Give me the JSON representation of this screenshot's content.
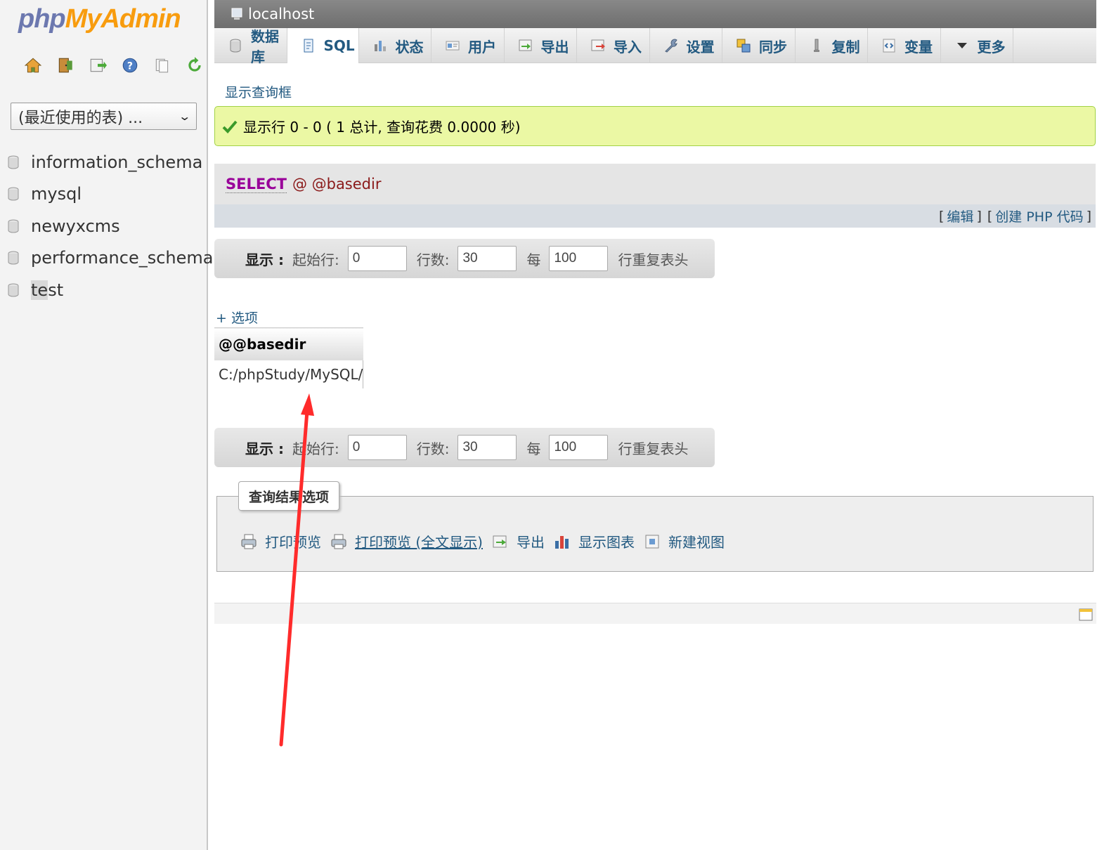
{
  "logo": {
    "part1": "php",
    "part2": "MyAdmin"
  },
  "nav_icons": [
    "home-icon",
    "logout-icon",
    "query-window-icon",
    "help-icon",
    "docs-icon",
    "reload-icon"
  ],
  "recent_tables": {
    "selected": "(最近使用的表) ..."
  },
  "databases": [
    {
      "name": "information_schema"
    },
    {
      "name": "mysql"
    },
    {
      "name": "newyxcms"
    },
    {
      "name": "performance_schema"
    },
    {
      "name_a": "te",
      "name_b": "st"
    }
  ],
  "server": {
    "title": "localhost"
  },
  "tabs": [
    {
      "label": "数据库",
      "icon": "database-icon"
    },
    {
      "label": "SQL",
      "icon": "sql-icon"
    },
    {
      "label": "状态",
      "icon": "status-icon"
    },
    {
      "label": "用户",
      "icon": "users-icon"
    },
    {
      "label": "导出",
      "icon": "export-icon"
    },
    {
      "label": "导入",
      "icon": "import-icon"
    },
    {
      "label": "设置",
      "icon": "settings-icon"
    },
    {
      "label": "同步",
      "icon": "sync-icon"
    },
    {
      "label": "复制",
      "icon": "replication-icon"
    },
    {
      "label": "变量",
      "icon": "variables-icon"
    },
    {
      "label": "更多",
      "icon": "chevron-down-icon"
    }
  ],
  "show_query_box": "显示查询框",
  "success_message": "显示行 0 - 0 ( 1 总计, 查询花费 0.0000 秒)",
  "sql": {
    "keyword": "SELECT",
    "rest": "@ @basedir"
  },
  "sql_tools": {
    "open1": "[",
    "edit": "编辑",
    "close1": "]",
    "open2": "[",
    "create_php": "创建 PHP 代码",
    "close2": "]"
  },
  "navigation": {
    "show_label": "显示 :",
    "start_row_label": "起始行:",
    "start_row_value": "0",
    "rows_label": "行数:",
    "rows_value": "30",
    "every_label": "每",
    "repeat_value": "100",
    "repeat_header_label": "行重复表头"
  },
  "options_link": "+ 选项",
  "result": {
    "column": "@@basedir",
    "value": "C:/phpStudy/MySQL/"
  },
  "query_results_options": {
    "legend": "查询结果选项",
    "links": [
      {
        "label": "打印预览",
        "icon": "print-icon"
      },
      {
        "label": "打印预览 (全文显示)",
        "icon": "print-full-icon"
      },
      {
        "label": "导出",
        "icon": "export-icon"
      },
      {
        "label": "显示图表",
        "icon": "chart-icon"
      },
      {
        "label": "新建视图",
        "icon": "view-icon"
      }
    ]
  },
  "colors": {
    "arrow": "#ff2b2b",
    "success_bg": "#ebf8a4",
    "link": "#235a81",
    "sql_keyword": "#990099"
  }
}
